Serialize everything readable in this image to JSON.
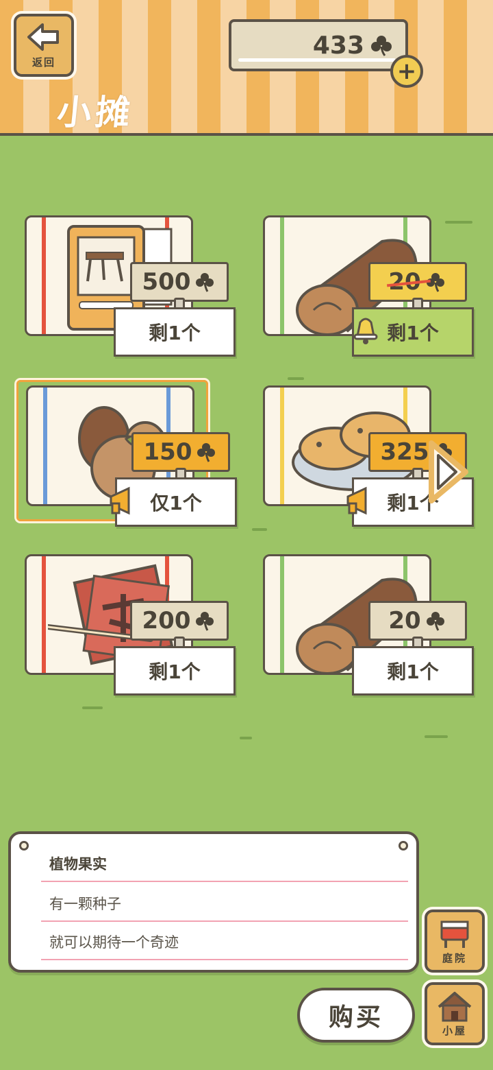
{
  "header": {
    "back_label": "返回",
    "title": "小摊",
    "currency_amount": "433",
    "add_symbol": "+"
  },
  "items": [
    {
      "price": "500",
      "stock": "剩1个",
      "name": "furniture-catalog"
    },
    {
      "price": "20",
      "stock": "剩1个",
      "name": "log",
      "sale": true
    },
    {
      "price": "150",
      "stock": "仅1个",
      "name": "plant-fruit",
      "selected": true
    },
    {
      "price": "325",
      "stock": "剩1个",
      "name": "taiyaki"
    },
    {
      "price": "200",
      "stock": "剩1个",
      "name": "calligraphy-paper"
    },
    {
      "price": "20",
      "stock": "剩1个",
      "name": "log"
    }
  ],
  "description": {
    "title": "植物果实",
    "line1": "有一颗种子",
    "line2": "就可以期待一个奇迹"
  },
  "buttons": {
    "yard": "庭院",
    "house": "小屋",
    "buy": "购买"
  },
  "colors": {
    "grass": "#9cc466",
    "stripe_orange": "#f1b55c",
    "stripe_cream": "#f7d4a4",
    "tag_orange": "#f2ae30",
    "tag_yellow": "#f3cf4f",
    "outline": "#5b5247"
  }
}
